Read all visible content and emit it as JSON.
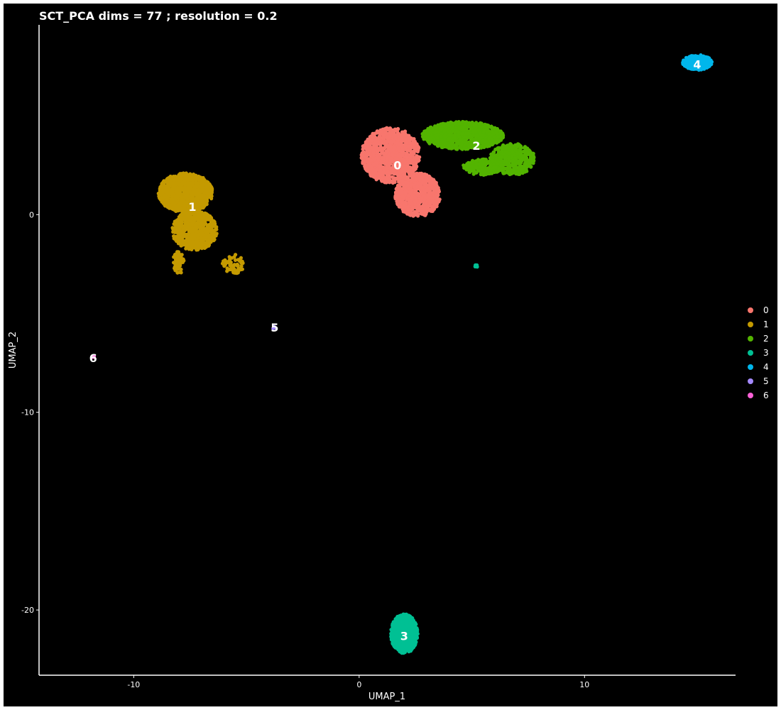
{
  "chart_data": {
    "type": "scatter",
    "title": "SCT_PCA dims =  77 ; resolution = 0.2",
    "xlabel": "UMAP_1",
    "ylabel": "UMAP_2",
    "xlim": [
      -14.2,
      16.7
    ],
    "ylim": [
      -23.3,
      9.6
    ],
    "x_ticks": [
      -10,
      0,
      10
    ],
    "y_ticks": [
      0,
      -10,
      -20
    ],
    "x_tick_labels": [
      "-10",
      "0",
      "10"
    ],
    "y_tick_labels": [
      "0",
      "-10",
      "-20"
    ],
    "grid": false,
    "legend_position": "right",
    "legend": [
      "0",
      "1",
      "2",
      "3",
      "4",
      "5",
      "6"
    ],
    "series": [
      {
        "name": "0",
        "color": "#F8766D",
        "center": [
          1.7,
          2.1
        ],
        "label_at": [
          1.7,
          2.5
        ],
        "blobs": [
          {
            "c": [
              1.4,
              3.0
            ],
            "r": [
              1.3,
              1.4
            ],
            "n": 1100
          },
          {
            "c": [
              2.6,
              1.0
            ],
            "r": [
              1.0,
              1.1
            ],
            "n": 700
          }
        ]
      },
      {
        "name": "1",
        "color": "#C49A00",
        "center": [
          -7.4,
          0.5
        ],
        "label_at": [
          -7.4,
          0.4
        ],
        "blobs": [
          {
            "c": [
              -7.7,
              1.1
            ],
            "r": [
              1.2,
              1.0
            ],
            "n": 1000
          },
          {
            "c": [
              -7.3,
              -0.8
            ],
            "r": [
              1.0,
              1.0
            ],
            "n": 600
          },
          {
            "c": [
              -8.0,
              -2.4
            ],
            "r": [
              0.25,
              0.6
            ],
            "n": 60
          },
          {
            "c": [
              -5.6,
              -2.5
            ],
            "r": [
              0.5,
              0.5
            ],
            "n": 60
          }
        ]
      },
      {
        "name": "2",
        "color": "#53B400",
        "center": [
          5.2,
          3.4
        ],
        "label_at": [
          5.2,
          3.5
        ],
        "blobs": [
          {
            "c": [
              4.6,
              4.0
            ],
            "r": [
              1.8,
              0.7
            ],
            "n": 900
          },
          {
            "c": [
              6.8,
              2.8
            ],
            "r": [
              1.0,
              0.8
            ],
            "n": 450
          },
          {
            "c": [
              5.5,
              2.4
            ],
            "r": [
              0.9,
              0.4
            ],
            "n": 200
          }
        ]
      },
      {
        "name": "3",
        "color": "#00C094",
        "center": [
          2.0,
          -21.2
        ],
        "label_at": [
          2.0,
          -21.3
        ],
        "blobs": [
          {
            "c": [
              2.0,
              -21.2
            ],
            "r": [
              0.6,
              1.0
            ],
            "n": 700
          },
          {
            "c": [
              5.2,
              -2.6
            ],
            "r": [
              0.06,
              0.08
            ],
            "n": 6
          }
        ]
      },
      {
        "name": "4",
        "color": "#00B6EB",
        "center": [
          15.0,
          7.7
        ],
        "label_at": [
          15.0,
          7.6
        ],
        "blobs": [
          {
            "c": [
              15.0,
              7.7
            ],
            "r": [
              0.65,
              0.38
            ],
            "n": 300
          }
        ]
      },
      {
        "name": "5",
        "color": "#A58AFF",
        "center": [
          -3.8,
          -5.7
        ],
        "label_at": [
          -3.75,
          -5.7
        ],
        "blobs": [
          {
            "c": [
              -3.8,
              -5.7
            ],
            "r": [
              0.06,
              0.05
            ],
            "n": 5
          }
        ]
      },
      {
        "name": "6",
        "color": "#FB61D7",
        "center": [
          -11.8,
          -7.2
        ],
        "label_at": [
          -11.8,
          -7.25
        ],
        "blobs": [
          {
            "c": [
              -11.8,
              -7.2
            ],
            "r": [
              0.05,
              0.05
            ],
            "n": 4
          }
        ]
      }
    ]
  }
}
